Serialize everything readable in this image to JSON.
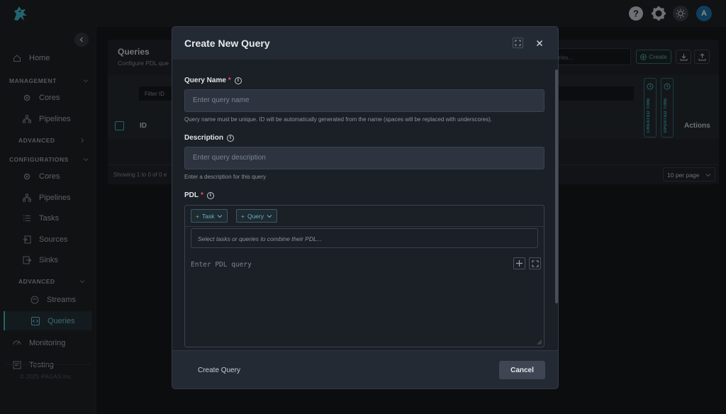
{
  "sidebar": {
    "home": "Home",
    "management_label": "MANAGEMENT",
    "management_items": [
      "Cores",
      "Pipelines"
    ],
    "advanced_label_1": "ADVANCED",
    "configurations_label": "CONFIGURATIONS",
    "config_items": [
      "Cores",
      "Pipelines",
      "Tasks",
      "Sources",
      "Sinks"
    ],
    "advanced_label_2": "ADVANCED",
    "advanced_items": [
      "Streams",
      "Queries"
    ],
    "monitoring": "Monitoring",
    "testing": "Testing",
    "footer": "© 2025 PAGAS Inc."
  },
  "topbar": {
    "avatar_initial": "A"
  },
  "page": {
    "title": "Queries",
    "subtitle": "Configure PDL que",
    "search_placeholder": "eries...",
    "create_label": "Create",
    "filter_placeholder": "Filter ID",
    "col_id": "ID",
    "col_created": "CREATED TIME",
    "col_updated": "UPDATED TIME",
    "col_actions": "Actions",
    "showing": "Showing 1 to 0 of 0 e",
    "per_page": "10 per page"
  },
  "modal": {
    "title": "Create New Query",
    "query_name_label": "Query Name",
    "query_name_placeholder": "Enter query name",
    "query_name_help": "Query name must be unique. ID will be automatically generated from the name (spaces will be replaced with underscores).",
    "description_label": "Description",
    "description_placeholder": "Enter query description",
    "description_help": "Enter a description for this query",
    "pdl_label": "PDL",
    "task_chip": "Task",
    "query_chip": "Query",
    "select_placeholder": "Select tasks or queries to combine their PDL...",
    "pdl_placeholder": "Enter PDL query",
    "create_button": "Create Query",
    "cancel_button": "Cancel",
    "required_mark": "*"
  },
  "colors": {
    "accent": "#3fb6c9",
    "required": "#e0556b",
    "success": "#4fbf8b"
  }
}
